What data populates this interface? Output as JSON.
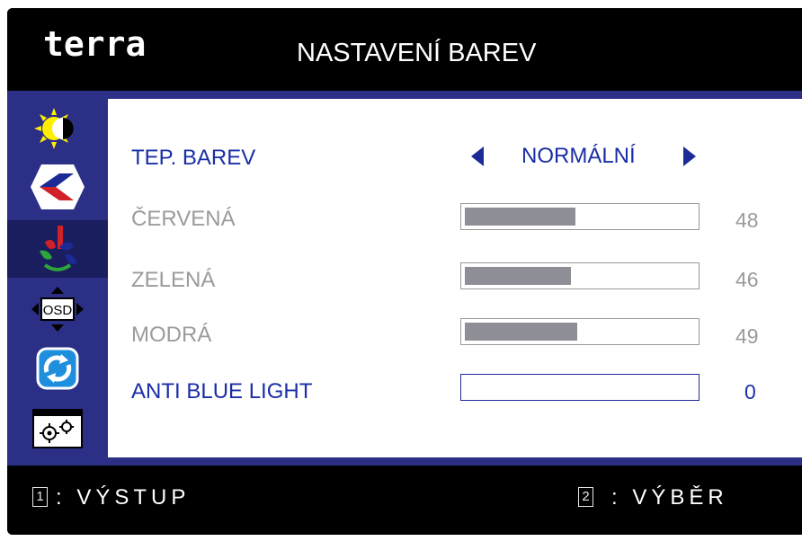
{
  "header": {
    "logo": "terra",
    "title": "NASTAVENÍ BAREV"
  },
  "sidebar": {
    "items": [
      {
        "icon": "brightness-contrast-icon",
        "selected": false
      },
      {
        "icon": "image-setting-icon",
        "selected": false
      },
      {
        "icon": "color-setting-icon",
        "selected": true
      },
      {
        "icon": "osd-setting-icon",
        "selected": false
      },
      {
        "icon": "reset-icon",
        "selected": false
      },
      {
        "icon": "misc-setting-icon",
        "selected": false
      }
    ]
  },
  "menu": {
    "color_temp": {
      "label": "TEP. BAREV",
      "value": "NORMÁLNÍ"
    },
    "red": {
      "label": "ČERVENÁ",
      "value": 48
    },
    "green": {
      "label": "ZELENÁ",
      "value": 46
    },
    "blue": {
      "label": "MODRÁ",
      "value": 49
    },
    "anti_blue": {
      "label": "ANTI BLUE LIGHT",
      "value": 0
    }
  },
  "footer": {
    "exit_key": "1",
    "exit_label": ": VÝSTUP",
    "select_key": "2",
    "select_label": ": VÝBĚR"
  },
  "colors": {
    "accent": "#2b2f86",
    "active_text": "#1a2ea8",
    "inactive_text": "#9b9b9b",
    "bar_fill": "#8e8e96"
  }
}
